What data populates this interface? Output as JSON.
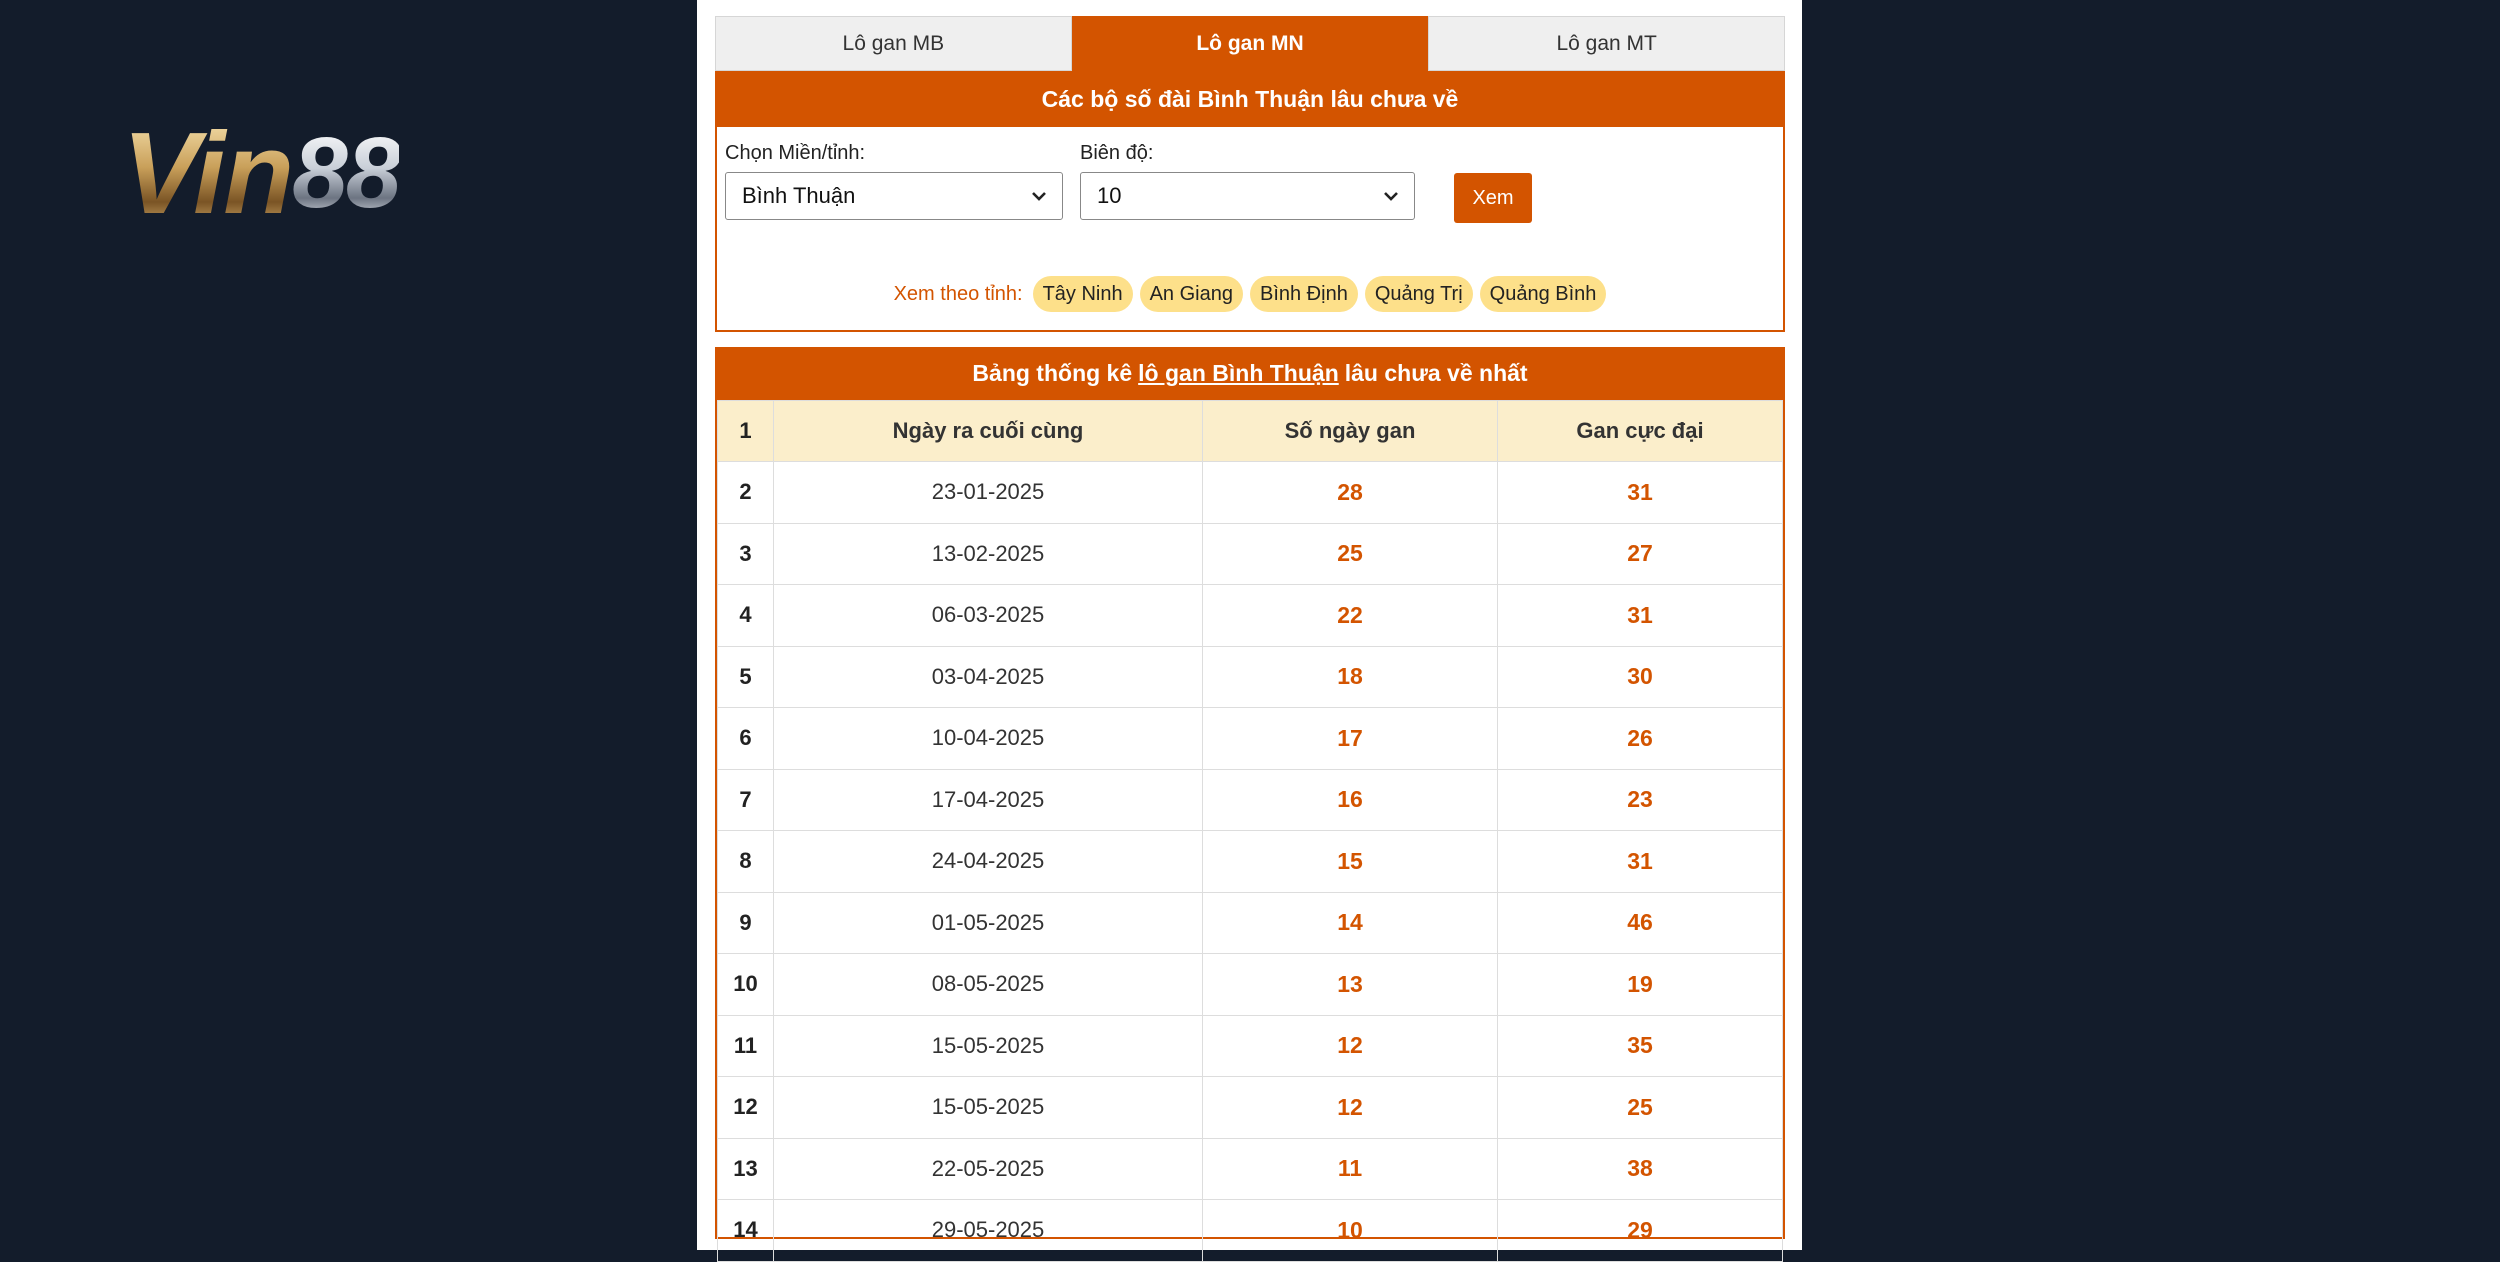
{
  "logo": {
    "vin": "Vin",
    "num": "88"
  },
  "tabs": [
    {
      "label": "Lô gan MB",
      "active": false
    },
    {
      "label": "Lô gan MN",
      "active": true
    },
    {
      "label": "Lô gan MT",
      "active": false
    }
  ],
  "filter": {
    "title": "Các bộ số đài Bình Thuận lâu chưa về",
    "region_label": "Chọn Miền/tỉnh:",
    "region_value": "Bình Thuận",
    "range_label": "Biên độ:",
    "range_value": "10",
    "submit_label": "Xem",
    "province_prompt": "Xem theo tỉnh:",
    "provinces": [
      "Tây Ninh",
      "An Giang",
      "Bình Định",
      "Quảng Trị",
      "Quảng Bình"
    ]
  },
  "stats": {
    "title_prefix": "Bảng thống kê",
    "title_link": "lô gan Bình Thuận",
    "title_suffix": "lâu chưa về nhất",
    "headers": [
      "1",
      "Ngày ra cuối cùng",
      "Số ngày gan",
      "Gan cực đại"
    ],
    "rows": [
      [
        "2",
        "23-01-2025",
        "28",
        "31"
      ],
      [
        "3",
        "13-02-2025",
        "25",
        "27"
      ],
      [
        "4",
        "06-03-2025",
        "22",
        "31"
      ],
      [
        "5",
        "03-04-2025",
        "18",
        "30"
      ],
      [
        "6",
        "10-04-2025",
        "17",
        "26"
      ],
      [
        "7",
        "17-04-2025",
        "16",
        "23"
      ],
      [
        "8",
        "24-04-2025",
        "15",
        "31"
      ],
      [
        "9",
        "01-05-2025",
        "14",
        "46"
      ],
      [
        "10",
        "08-05-2025",
        "13",
        "19"
      ],
      [
        "11",
        "15-05-2025",
        "12",
        "35"
      ],
      [
        "12",
        "15-05-2025",
        "12",
        "25"
      ],
      [
        "13",
        "22-05-2025",
        "11",
        "38"
      ],
      [
        "14",
        "29-05-2025",
        "10",
        "29"
      ]
    ]
  },
  "colors": {
    "accent": "#d35400",
    "chip": "#fde08a",
    "header_bg": "#fbeecb",
    "background": "#131c2b"
  }
}
